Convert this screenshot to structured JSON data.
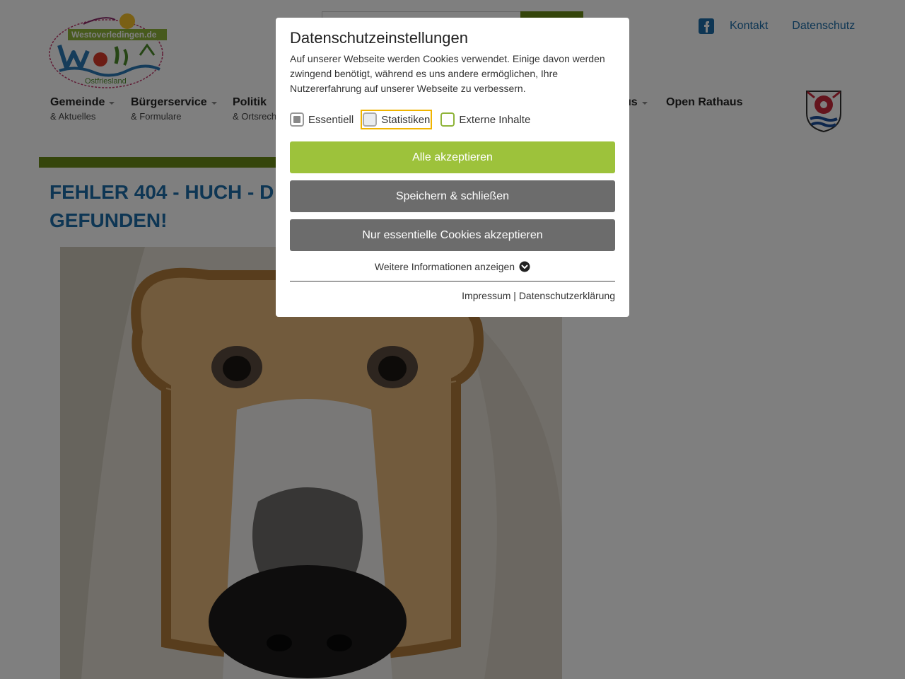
{
  "header": {
    "logo_text": "Westoverledingen.de",
    "logo_sub": "Ostfriesland",
    "top_links": [
      "Kontakt",
      "Datenschutz"
    ],
    "nav": [
      {
        "title": "Gemeinde",
        "sub": "& Aktuelles",
        "caret": true
      },
      {
        "title": "Bürgerservice",
        "sub": "& Formulare",
        "caret": true
      },
      {
        "title": "Politik",
        "sub": "& Ortsrecht",
        "caret": false
      },
      {
        "title": "us",
        "sub": "",
        "caret": true
      },
      {
        "title": "Open Rathaus",
        "sub": "",
        "caret": false
      }
    ]
  },
  "main": {
    "error_title": "FEHLER 404 - HUCH - D",
    "error_title_line2": "GEFUNDEN!"
  },
  "cookie_modal": {
    "title": "Datenschutzeinstellungen",
    "text": "Auf unserer Webseite werden Cookies verwendet. Einige davon werden zwingend benötigt, während es uns andere ermöglichen, Ihre Nutzererfahrung auf unserer Webseite zu verbessern.",
    "options": [
      {
        "label": "Essentiell",
        "state": "disabled-checked"
      },
      {
        "label": "Statistiken",
        "state": "focused-unchecked"
      },
      {
        "label": "Externe Inhalte",
        "state": "unchecked"
      }
    ],
    "accept_all": "Alle akzeptieren",
    "save_close": "Speichern & schließen",
    "essential_only": "Nur essentielle Cookies akzeptieren",
    "more_info": "Weitere Informationen anzeigen",
    "impressum": "Impressum",
    "separator": " | ",
    "privacy": "Datenschutzerklärung"
  },
  "colors": {
    "accent_green": "#9dc23b",
    "dark_green": "#6a8a16",
    "button_grey": "#6c6c6c",
    "link_blue": "#1d6da8",
    "focus_outline": "#f0b400"
  }
}
